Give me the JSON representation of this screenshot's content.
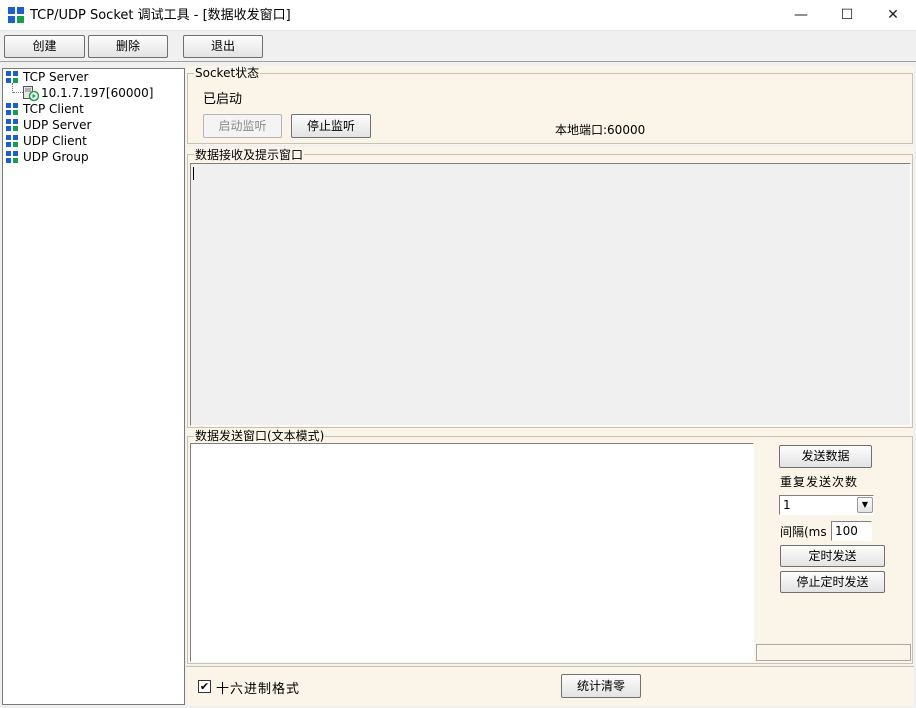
{
  "window": {
    "title": "TCP/UDP Socket 调试工具 - [数据收发窗口]",
    "controls": {
      "minimize": "—",
      "maximize": "☐",
      "close": "✕"
    }
  },
  "toolbar": {
    "create": "创建",
    "delete": "删除",
    "exit": "退出"
  },
  "tree": {
    "items": [
      {
        "label": "TCP Server"
      },
      {
        "label": "10.1.7.197[60000]"
      },
      {
        "label": "TCP Client"
      },
      {
        "label": "UDP Server"
      },
      {
        "label": "UDP Client"
      },
      {
        "label": "UDP Group"
      }
    ]
  },
  "socket_status": {
    "title": "Socket状态",
    "state": "已启动",
    "start_listen": "启动监听",
    "stop_listen": "停止监听",
    "local_port": "本地端口:60000"
  },
  "receive": {
    "title": "数据接收及提示窗口",
    "content": ""
  },
  "send": {
    "title": "数据发送窗口(文本模式)",
    "content": "",
    "send_button": "发送数据",
    "repeat_label": "重复发送次数",
    "repeat_value": "1",
    "interval_label": "间隔(ms",
    "interval_value": "100",
    "timed_send": "定时发送",
    "stop_timed_send": "停止定时发送"
  },
  "footer": {
    "hex_label": "十六进制格式",
    "hex_checked": true,
    "reset_stats": "统计清零"
  },
  "colors": {
    "panel_bg": "#faf5e8",
    "frame_bg": "#f0f0f0",
    "icon_blue": "#1a5fd0",
    "icon_green": "#12a24a"
  }
}
